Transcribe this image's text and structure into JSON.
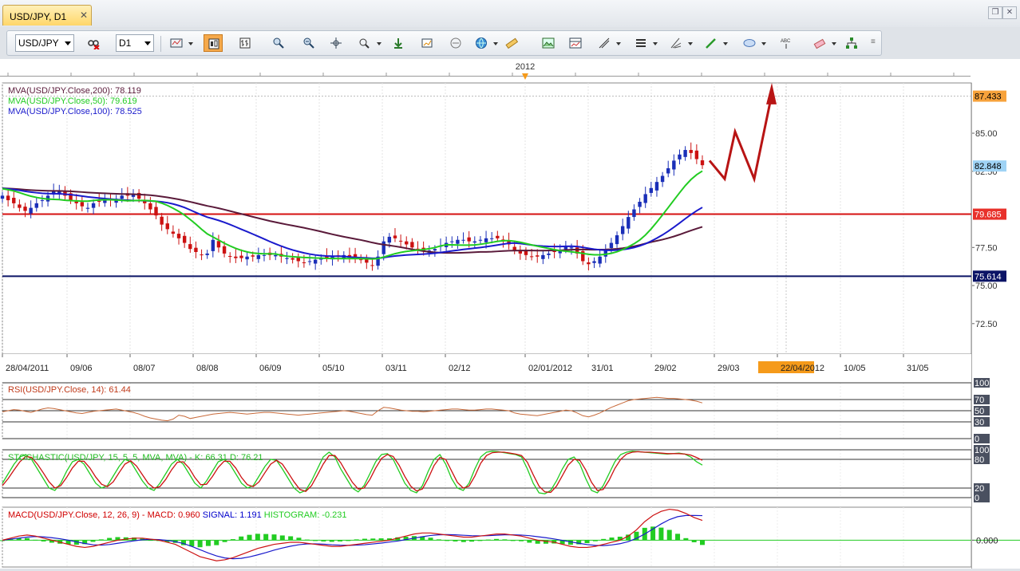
{
  "window": {
    "tab_label": "USD/JPY, D1",
    "tab_close": "✕",
    "restore_label": "❐",
    "close_label": "✕"
  },
  "toolbar": {
    "symbol": "USD/JPY",
    "timeframe": "D1",
    "buttons": [
      "chart-type-icon",
      "candles-icon",
      "bars-icon",
      "zoom-in-icon",
      "zoom-out-icon",
      "crosshair-icon",
      "zoom-fit-icon",
      "auto-scroll-icon",
      "chart-shift-icon",
      "period-separators-icon",
      "globe-icon",
      "ruler-icon",
      "screenshot-icon",
      "template-icon",
      "lines-icon",
      "indicators-icon",
      "fibonacci-icon",
      "pen-icon",
      "ellipse-icon",
      "text-icon",
      "eraser-icon",
      "objects-list-icon"
    ]
  },
  "chart_data": [
    {
      "type": "candlestick",
      "title": "USD/JPY, D1",
      "year_marker": "2012",
      "legend": [
        {
          "text": "MVA(USD/JPY.Close,200): 78.119",
          "color": "#5a1a3a"
        },
        {
          "text": "MVA(USD/JPY.Close,50): 79.619",
          "color": "#22cc22"
        },
        {
          "text": "MVA(USD/JPY.Close,100): 78.525",
          "color": "#1a1acc"
        }
      ],
      "x_tick_labels": [
        "28/04/2011",
        "09/06",
        "08/07",
        "08/08",
        "06/09",
        "05/10",
        "03/11",
        "02/12",
        "02/01/2012",
        "31/01",
        "29/02",
        "29/03",
        "22/04/2012",
        "10/05",
        "31/05"
      ],
      "highlighted_date": "22/04/2012",
      "y_tick_labels": [
        "85.00",
        "82.50",
        "77.50",
        "75.00",
        "72.50"
      ],
      "ylim": [
        70.5,
        88.3
      ],
      "price_labels": [
        {
          "value": 87.433,
          "text": "87.433",
          "bg": "#f7a23b",
          "fg": "#000000"
        },
        {
          "value": 82.848,
          "text": "82.848",
          "bg": "#9fd3f5",
          "fg": "#000000"
        },
        {
          "value": 79.685,
          "text": "79.685",
          "bg": "#e8312b",
          "fg": "#ffffff"
        },
        {
          "value": 75.614,
          "text": "75.614",
          "bg": "#0b1466",
          "fg": "#ffffff"
        }
      ],
      "horizontal_lines": [
        {
          "value": 79.685,
          "color": "#d61010"
        },
        {
          "value": 75.614,
          "color": "#0b1466"
        }
      ],
      "close_series": [
        80.9,
        80.6,
        80.4,
        80.1,
        79.9,
        80.1,
        80.4,
        80.6,
        80.9,
        81.2,
        81.2,
        80.9,
        80.6,
        80.4,
        80.2,
        80.1,
        80.4,
        80.5,
        80.6,
        80.6,
        80.7,
        80.9,
        80.9,
        81.0,
        80.7,
        80.4,
        80.0,
        79.6,
        79.0,
        78.7,
        78.4,
        78.1,
        77.8,
        77.4,
        77.2,
        77.0,
        77.1,
        78.0,
        77.5,
        77.1,
        76.9,
        76.8,
        76.8,
        76.9,
        76.9,
        77.0,
        77.0,
        77.0,
        77.0,
        76.9,
        76.8,
        76.7,
        76.6,
        76.5,
        76.6,
        76.7,
        76.8,
        76.8,
        76.9,
        76.9,
        77.0,
        76.9,
        76.8,
        76.7,
        76.5,
        76.3,
        76.9,
        77.9,
        78.2,
        78.1,
        77.9,
        77.7,
        77.5,
        77.4,
        77.3,
        77.3,
        77.4,
        77.6,
        77.8,
        77.9,
        78.0,
        78.0,
        77.9,
        77.9,
        78.0,
        78.1,
        78.1,
        78.1,
        77.9,
        77.7,
        77.3,
        77.1,
        77.0,
        76.9,
        76.9,
        77.0,
        77.1,
        77.2,
        77.3,
        77.6,
        77.5,
        77.1,
        76.6,
        76.4,
        76.6,
        76.9,
        77.3,
        77.8,
        78.3,
        78.9,
        79.5,
        80.0,
        80.5,
        81.0,
        81.4,
        81.8,
        82.2,
        82.7,
        83.2,
        83.6,
        83.9,
        83.7,
        83.3,
        82.9
      ],
      "forecast_path": [
        83.2,
        82.0,
        85.1,
        82.0,
        87.3
      ]
    },
    {
      "type": "line",
      "title": "RSI(USD/JPY.Close, 14): 61.44",
      "levels": [
        "100",
        "70",
        "50",
        "30",
        "0"
      ],
      "ylim": [
        0,
        100
      ],
      "values": [
        48,
        50,
        52,
        51,
        49,
        47,
        50,
        53,
        55,
        54,
        52,
        50,
        48,
        46,
        45,
        47,
        49,
        50,
        51,
        52,
        53,
        51,
        49,
        47,
        44,
        40,
        37,
        35,
        33,
        32,
        35,
        42,
        40,
        36,
        38,
        40,
        42,
        44,
        45,
        46,
        47,
        46,
        45,
        44,
        45,
        46,
        47,
        47,
        46,
        45,
        44,
        43,
        42,
        43,
        44,
        45,
        46,
        47,
        48,
        49,
        50,
        49,
        47,
        45,
        43,
        42,
        50,
        56,
        55,
        53,
        51,
        50,
        49,
        49,
        48,
        49,
        50,
        51,
        52,
        53,
        53,
        52,
        51,
        51,
        52,
        53,
        53,
        52,
        51,
        50,
        46,
        44,
        43,
        42,
        41,
        43,
        45,
        47,
        49,
        51,
        50,
        46,
        41,
        39,
        42,
        46,
        51,
        56,
        60,
        64,
        68,
        70,
        71,
        72,
        73,
        74,
        73,
        72,
        72,
        71,
        70,
        69,
        67,
        64
      ]
    },
    {
      "type": "line",
      "title": "STOCHASTIC(USD/JPY, 15, 5, 5, MVA, MVA) -  K: 66.31  D: 76.21",
      "levels": [
        "100",
        "80",
        "20",
        "0"
      ],
      "ylim": [
        0,
        100
      ],
      "k_values": [
        30,
        50,
        70,
        85,
        90,
        80,
        60,
        40,
        20,
        15,
        30,
        55,
        75,
        80,
        70,
        50,
        30,
        20,
        25,
        45,
        65,
        80,
        75,
        55,
        35,
        20,
        15,
        30,
        50,
        70,
        80,
        70,
        50,
        30,
        20,
        35,
        55,
        75,
        80,
        70,
        50,
        30,
        20,
        25,
        45,
        65,
        80,
        78,
        60,
        40,
        20,
        10,
        15,
        35,
        60,
        85,
        95,
        85,
        60,
        40,
        20,
        12,
        25,
        50,
        75,
        90,
        92,
        80,
        55,
        30,
        15,
        10,
        25,
        55,
        80,
        90,
        70,
        40,
        20,
        15,
        30,
        60,
        85,
        95,
        97,
        96,
        94,
        92,
        90,
        85,
        60,
        30,
        10,
        8,
        15,
        35,
        60,
        80,
        85,
        70,
        40,
        15,
        10,
        25,
        50,
        75,
        90,
        95,
        97,
        96,
        95,
        94,
        93,
        92,
        91,
        92,
        93,
        91,
        85,
        75,
        68
      ],
      "d_values": [
        25,
        40,
        58,
        75,
        86,
        84,
        70,
        52,
        33,
        20,
        25,
        42,
        62,
        76,
        76,
        62,
        43,
        28,
        23,
        33,
        52,
        70,
        77,
        66,
        48,
        30,
        20,
        23,
        38,
        58,
        74,
        75,
        62,
        42,
        27,
        28,
        44,
        63,
        76,
        76,
        62,
        42,
        27,
        23,
        33,
        52,
        70,
        78,
        70,
        52,
        33,
        17,
        13,
        25,
        47,
        70,
        88,
        88,
        73,
        52,
        32,
        18,
        20,
        38,
        62,
        82,
        90,
        86,
        68,
        44,
        24,
        14,
        18,
        40,
        67,
        84,
        80,
        56,
        32,
        20,
        24,
        45,
        72,
        88,
        94,
        95,
        95,
        93,
        91,
        88,
        74,
        48,
        24,
        12,
        11,
        24,
        46,
        68,
        80,
        78,
        58,
        32,
        15,
        17,
        36,
        61,
        80,
        91,
        95,
        96,
        95,
        95,
        94,
        93,
        92,
        92,
        92,
        91,
        89,
        84,
        78
      ]
    },
    {
      "type": "line",
      "title_parts": [
        {
          "text": "MACD(USD/JPY.Close, 12, 26, 9) -  MACD: 0.960",
          "color": "#d00000"
        },
        {
          "text": "SIGNAL: 1.191",
          "color": "#0000cc"
        },
        {
          "text": "HISTOGRAM: -0.231",
          "color": "#22cc22"
        }
      ],
      "zero_label": "0.000",
      "ylim": [
        -1.3,
        1.6
      ],
      "macd": [
        0.0,
        0.1,
        0.2,
        0.25,
        0.2,
        0.1,
        0.0,
        -0.1,
        -0.2,
        -0.3,
        -0.35,
        -0.3,
        -0.2,
        -0.1,
        0.0,
        0.05,
        0.1,
        0.1,
        0.05,
        0.0,
        -0.1,
        -0.2,
        -0.4,
        -0.6,
        -0.8,
        -0.9,
        -1.0,
        -0.95,
        -0.85,
        -0.7,
        -0.55,
        -0.4,
        -0.3,
        -0.2,
        -0.15,
        -0.1,
        -0.1,
        -0.15,
        -0.2,
        -0.25,
        -0.3,
        -0.3,
        -0.25,
        -0.2,
        -0.15,
        -0.1,
        -0.05,
        0.0,
        0.1,
        0.2,
        0.3,
        0.35,
        0.35,
        0.3,
        0.25,
        0.2,
        0.15,
        0.15,
        0.2,
        0.25,
        0.3,
        0.3,
        0.25,
        0.2,
        0.1,
        0.0,
        -0.05,
        -0.1,
        -0.2,
        -0.3,
        -0.35,
        -0.35,
        -0.3,
        -0.2,
        -0.1,
        0.0,
        0.2,
        0.5,
        0.9,
        1.2,
        1.4,
        1.5,
        1.45,
        1.3,
        1.1,
        0.96
      ],
      "signal": [
        0.0,
        0.05,
        0.1,
        0.15,
        0.18,
        0.16,
        0.12,
        0.07,
        0.0,
        -0.08,
        -0.16,
        -0.22,
        -0.24,
        -0.21,
        -0.15,
        -0.09,
        -0.03,
        0.02,
        0.04,
        0.03,
        -0.01,
        -0.07,
        -0.16,
        -0.3,
        -0.46,
        -0.62,
        -0.76,
        -0.86,
        -0.9,
        -0.88,
        -0.81,
        -0.71,
        -0.6,
        -0.48,
        -0.38,
        -0.29,
        -0.22,
        -0.18,
        -0.18,
        -0.19,
        -0.22,
        -0.24,
        -0.25,
        -0.24,
        -0.22,
        -0.18,
        -0.14,
        -0.09,
        -0.04,
        0.03,
        0.1,
        0.17,
        0.23,
        0.26,
        0.27,
        0.26,
        0.24,
        0.22,
        0.21,
        0.22,
        0.24,
        0.26,
        0.26,
        0.25,
        0.22,
        0.17,
        0.12,
        0.06,
        -0.01,
        -0.08,
        -0.15,
        -0.21,
        -0.25,
        -0.26,
        -0.23,
        -0.17,
        -0.07,
        0.09,
        0.3,
        0.54,
        0.79,
        1.0,
        1.14,
        1.2,
        1.2,
        1.191
      ],
      "histogram": [
        0.0,
        0.05,
        0.1,
        0.1,
        0.02,
        -0.06,
        -0.12,
        -0.17,
        -0.2,
        -0.22,
        -0.19,
        -0.08,
        0.04,
        0.11,
        0.15,
        0.14,
        0.13,
        0.08,
        0.01,
        -0.03,
        -0.09,
        -0.13,
        -0.24,
        -0.3,
        -0.34,
        -0.28,
        -0.24,
        -0.09,
        0.05,
        0.18,
        0.26,
        0.31,
        0.3,
        0.28,
        0.23,
        0.19,
        0.12,
        0.03,
        -0.02,
        -0.06,
        -0.08,
        -0.06,
        0.0,
        0.04,
        0.07,
        0.08,
        0.09,
        0.09,
        0.14,
        0.17,
        0.2,
        0.18,
        0.12,
        0.04,
        -0.02,
        -0.06,
        -0.09,
        -0.07,
        -0.01,
        0.03,
        0.06,
        0.04,
        -0.01,
        -0.05,
        -0.12,
        -0.17,
        -0.17,
        -0.16,
        -0.19,
        -0.22,
        -0.2,
        -0.14,
        -0.05,
        0.06,
        0.13,
        0.17,
        0.27,
        0.41,
        0.6,
        0.66,
        0.61,
        0.5,
        0.31,
        0.1,
        -0.1,
        -0.231
      ]
    }
  ]
}
